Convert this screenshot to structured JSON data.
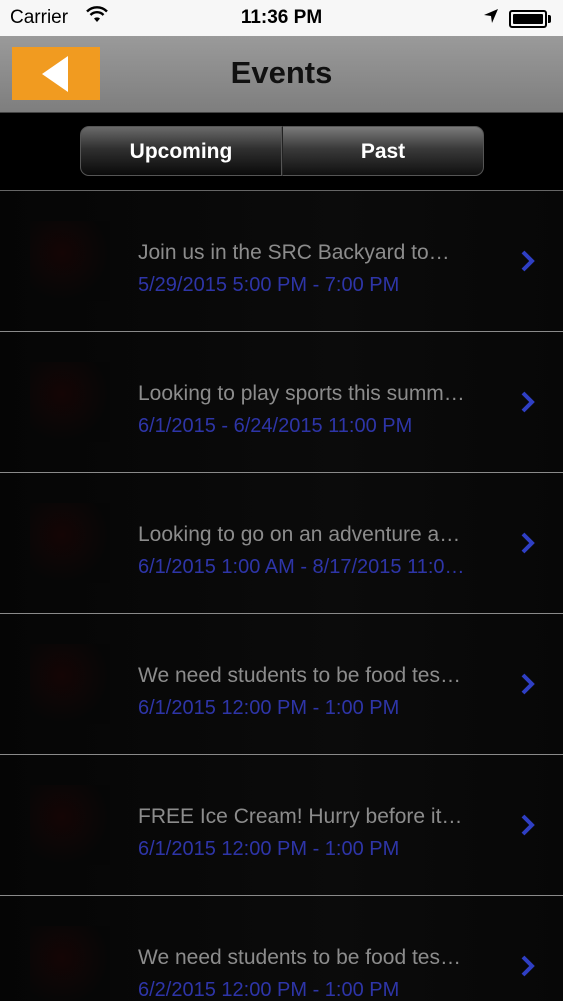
{
  "status_bar": {
    "carrier": "Carrier",
    "time": "11:36 PM"
  },
  "nav": {
    "title": "Events"
  },
  "tabs": [
    {
      "label": "Upcoming",
      "selected": true
    },
    {
      "label": "Past",
      "selected": false
    }
  ],
  "events": [
    {
      "title": "Join us in the SRC Backyard to…",
      "date": "5/29/2015 5:00 PM - 7:00 PM"
    },
    {
      "title": "Looking to play sports this summ…",
      "date": "6/1/2015 - 6/24/2015 11:00 PM"
    },
    {
      "title": "Looking to go on an adventure a…",
      "date": "6/1/2015 1:00 AM - 8/17/2015 11:0…"
    },
    {
      "title": "We need students to be food tes…",
      "date": "6/1/2015 12:00 PM - 1:00 PM"
    },
    {
      "title": "FREE Ice Cream! Hurry before it…",
      "date": "6/1/2015 12:00 PM - 1:00 PM"
    },
    {
      "title": "We need students to be food tes…",
      "date": "6/2/2015 12:00 PM - 1:00 PM"
    }
  ],
  "colors": {
    "accent": "#f19b20",
    "date_text": "#2e35a8",
    "title_text": "#8c8c8c"
  }
}
